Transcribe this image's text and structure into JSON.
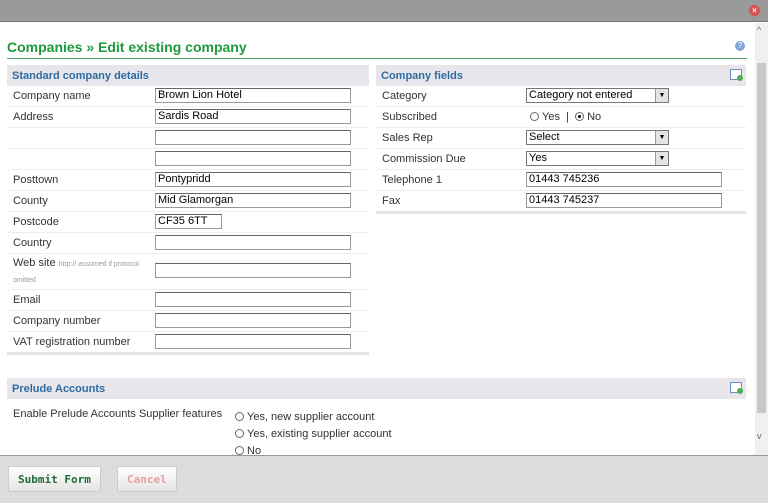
{
  "dialog": {
    "close_icon": "close-icon"
  },
  "page": {
    "title": "Companies » Edit existing company",
    "help_icon": "help-icon"
  },
  "standard": {
    "heading": "Standard company details",
    "rows": [
      {
        "label": "Company name",
        "value": "Brown Lion Hotel"
      },
      {
        "label": "Address",
        "value": "Sardis Road"
      },
      {
        "label": "",
        "value": ""
      },
      {
        "label": "",
        "value": ""
      },
      {
        "label": "Posttown",
        "value": "Pontypridd"
      },
      {
        "label": "County",
        "value": "Mid Glamorgan"
      },
      {
        "label": "Postcode",
        "value": "CF35 6TT"
      },
      {
        "label": "Country",
        "value": ""
      },
      {
        "label": "Web site",
        "hint": "http:// assumed if protocol omitted",
        "value": ""
      },
      {
        "label": "Email",
        "value": ""
      },
      {
        "label": "Company number",
        "value": ""
      },
      {
        "label": "VAT registration number",
        "value": ""
      }
    ]
  },
  "fields": {
    "heading": "Company fields",
    "category": {
      "label": "Category",
      "value": "Category not entered"
    },
    "subscribed": {
      "label": "Subscribed",
      "yes": "Yes",
      "sep": "|",
      "no": "No",
      "selected": "No"
    },
    "sales_rep": {
      "label": "Sales Rep",
      "value": "Select"
    },
    "commission": {
      "label": "Commission Due",
      "value": "Yes"
    },
    "telephone": {
      "label": "Telephone 1",
      "value": "01443 745236"
    },
    "fax": {
      "label": "Fax",
      "value": "01443 745237"
    }
  },
  "prelude": {
    "heading": "Prelude Accounts",
    "label": "Enable Prelude Accounts Supplier features",
    "options": [
      "Yes, new supplier account",
      "Yes, existing supplier account",
      "No"
    ]
  },
  "footer": {
    "submit": "Submit Form",
    "cancel": "Cancel"
  },
  "colors": {
    "title": "#1e9a3c",
    "section_heading": "#2b6ca3",
    "submit": "#1f6b3a",
    "cancel": "#e8a0a0"
  }
}
